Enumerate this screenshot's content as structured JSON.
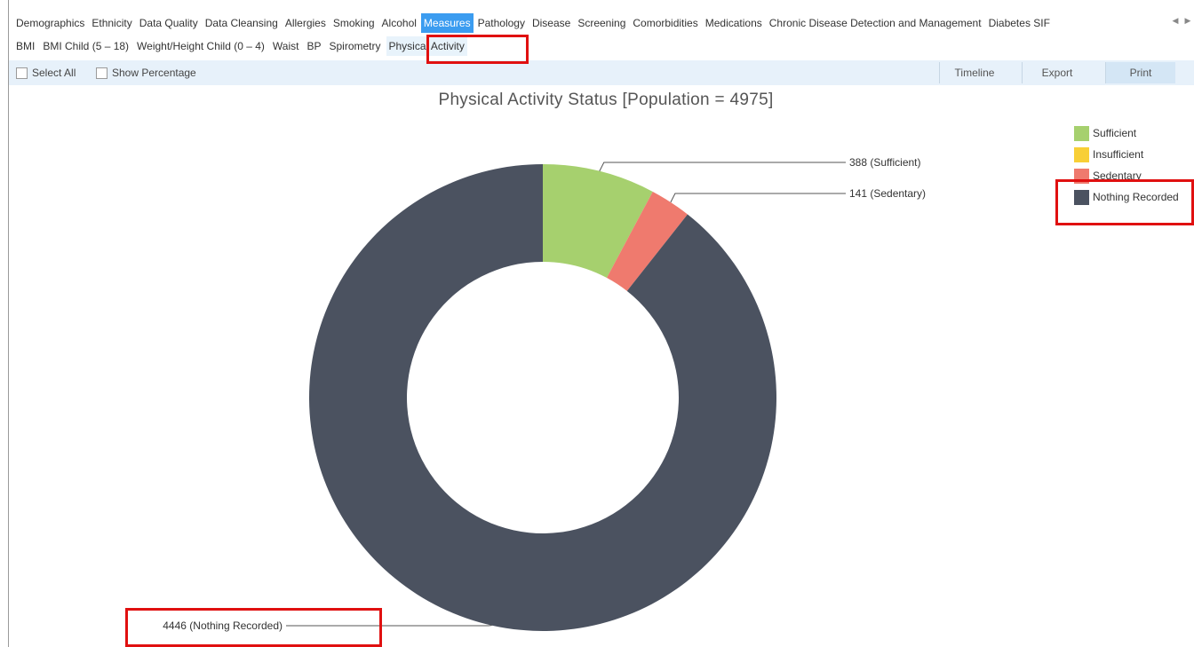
{
  "tabs": [
    {
      "label": "Demographics"
    },
    {
      "label": "Ethnicity"
    },
    {
      "label": "Data Quality"
    },
    {
      "label": "Data Cleansing"
    },
    {
      "label": "Allergies"
    },
    {
      "label": "Smoking"
    },
    {
      "label": "Alcohol"
    },
    {
      "label": "Measures",
      "active": true
    },
    {
      "label": "Pathology"
    },
    {
      "label": "Disease"
    },
    {
      "label": "Screening"
    },
    {
      "label": "Comorbidities"
    },
    {
      "label": "Medications"
    },
    {
      "label": "Chronic Disease Detection and Management"
    },
    {
      "label": "Diabetes SIF"
    }
  ],
  "tab_scroll": {
    "left_icon": "triangle-left-icon",
    "right_icon": "triangle-right-icon"
  },
  "subtabs": [
    {
      "label": "BMI"
    },
    {
      "label": "BMI Child (5 – 18)"
    },
    {
      "label": "Weight/Height Child (0 – 4)"
    },
    {
      "label": "Waist"
    },
    {
      "label": "BP"
    },
    {
      "label": "Spirometry"
    },
    {
      "label": "Physical Activity",
      "active": true
    }
  ],
  "toolbar": {
    "select_all": "Select All",
    "show_percentage": "Show Percentage",
    "timeline": "Timeline",
    "export": "Export",
    "print": "Print"
  },
  "highlight_color": "#e01010",
  "chart_data": {
    "type": "pie",
    "donut": true,
    "title": "Physical Activity Status [Population = 4975]",
    "legend_position": "top-right",
    "slices": [
      {
        "name": "Sufficient",
        "value": 388,
        "color": "#a6d06e",
        "label": "388 (Sufficient)"
      },
      {
        "name": "Insufficient",
        "value": 0,
        "color": "#f8cf36"
      },
      {
        "name": "Sedentary",
        "value": 141,
        "color": "#ef7a6e",
        "label": "141 (Sedentary)"
      },
      {
        "name": "Nothing Recorded",
        "value": 4446,
        "color": "#4b5260",
        "label": "4446 (Nothing Recorded)"
      }
    ]
  }
}
